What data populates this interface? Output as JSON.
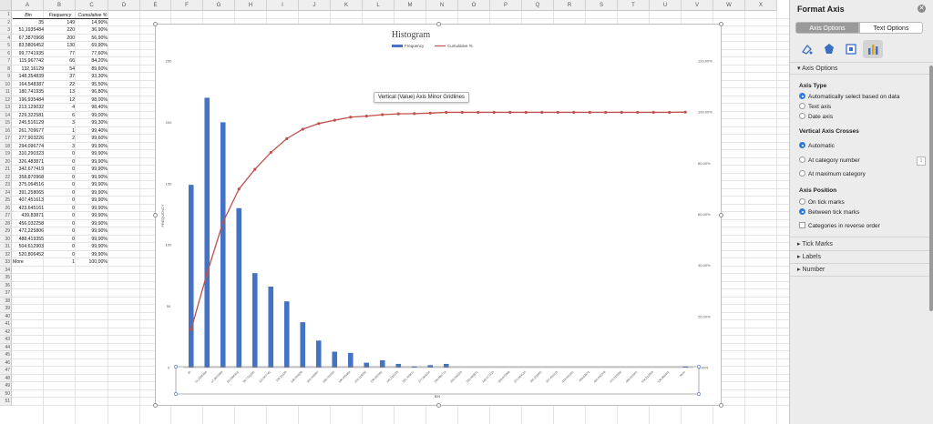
{
  "spreadsheet": {
    "columns": [
      "A",
      "B",
      "C",
      "D",
      "E",
      "F",
      "G",
      "H",
      "I",
      "J",
      "K",
      "L",
      "M",
      "N",
      "O",
      "P",
      "Q",
      "R",
      "S",
      "T",
      "U",
      "V",
      "W",
      "X"
    ],
    "row_numbers": [
      "1",
      "2",
      "3",
      "4",
      "5",
      "6",
      "7",
      "8",
      "9",
      "10",
      "11",
      "12",
      "13",
      "14",
      "15",
      "16",
      "17",
      "18",
      "19",
      "20",
      "21",
      "22",
      "23",
      "24",
      "25",
      "26",
      "27",
      "28",
      "29",
      "30",
      "31",
      "32",
      "33",
      "34",
      "35",
      "36",
      "37",
      "38",
      "39",
      "40",
      "41",
      "42",
      "43",
      "44",
      "45",
      "46",
      "47",
      "48",
      "49",
      "50",
      "51"
    ],
    "headers": {
      "bin": "Bin",
      "frequency": "Frequency",
      "cumulative": "Cumulative %"
    },
    "rows": [
      {
        "bin": "35",
        "freq": "149",
        "cum": "14,90%"
      },
      {
        "bin": "51,1935484",
        "freq": "220",
        "cum": "36,90%"
      },
      {
        "bin": "67,3870968",
        "freq": "200",
        "cum": "56,90%"
      },
      {
        "bin": "83,5806452",
        "freq": "130",
        "cum": "69,90%"
      },
      {
        "bin": "99,7741935",
        "freq": "77",
        "cum": "77,60%"
      },
      {
        "bin": "115,967742",
        "freq": "66",
        "cum": "84,20%"
      },
      {
        "bin": "132,16129",
        "freq": "54",
        "cum": "89,60%"
      },
      {
        "bin": "148,354839",
        "freq": "37",
        "cum": "93,30%"
      },
      {
        "bin": "164,548387",
        "freq": "22",
        "cum": "95,50%"
      },
      {
        "bin": "180,741935",
        "freq": "13",
        "cum": "96,80%"
      },
      {
        "bin": "196,935484",
        "freq": "12",
        "cum": "98,00%"
      },
      {
        "bin": "213,129032",
        "freq": "4",
        "cum": "98,40%"
      },
      {
        "bin": "229,322581",
        "freq": "6",
        "cum": "99,00%"
      },
      {
        "bin": "245,516129",
        "freq": "3",
        "cum": "99,30%"
      },
      {
        "bin": "261,709677",
        "freq": "1",
        "cum": "99,40%"
      },
      {
        "bin": "277,903226",
        "freq": "2",
        "cum": "99,60%"
      },
      {
        "bin": "294,096774",
        "freq": "3",
        "cum": "99,90%"
      },
      {
        "bin": "310,290323",
        "freq": "0",
        "cum": "99,90%"
      },
      {
        "bin": "326,483871",
        "freq": "0",
        "cum": "99,90%"
      },
      {
        "bin": "342,677419",
        "freq": "0",
        "cum": "99,90%"
      },
      {
        "bin": "358,870968",
        "freq": "0",
        "cum": "99,90%"
      },
      {
        "bin": "375,064516",
        "freq": "0",
        "cum": "99,90%"
      },
      {
        "bin": "391,258065",
        "freq": "0",
        "cum": "99,90%"
      },
      {
        "bin": "407,451613",
        "freq": "0",
        "cum": "99,90%"
      },
      {
        "bin": "423,645161",
        "freq": "0",
        "cum": "99,90%"
      },
      {
        "bin": "439,83871",
        "freq": "0",
        "cum": "99,90%"
      },
      {
        "bin": "456,032258",
        "freq": "0",
        "cum": "99,90%"
      },
      {
        "bin": "472,225806",
        "freq": "0",
        "cum": "99,90%"
      },
      {
        "bin": "488,419355",
        "freq": "0",
        "cum": "99,90%"
      },
      {
        "bin": "504,612903",
        "freq": "0",
        "cum": "99,90%"
      },
      {
        "bin": "520,806452",
        "freq": "0",
        "cum": "99,90%"
      },
      {
        "bin": "More",
        "freq": "1",
        "cum": "100,00%"
      }
    ]
  },
  "chart_data": {
    "type": "bar",
    "title": "Histogram",
    "xlabel": "BIN",
    "ylabel": "FREQUENCY",
    "categories": [
      "35",
      "51,1935484",
      "67,3870968",
      "83,5806452",
      "99,7741935",
      "115,967742",
      "132,16129",
      "148,354839",
      "164,548387",
      "180,741935",
      "196,935484",
      "213,129032",
      "229,322581",
      "245,516129",
      "261,709677",
      "277,903226",
      "294,096774",
      "310,290323",
      "326,483871",
      "342,677419",
      "358,870968",
      "375,064516",
      "391,258065",
      "407,451613",
      "423,645161",
      "439,83871",
      "456,032258",
      "472,225806",
      "488,419355",
      "504,612903",
      "520,806452",
      "More"
    ],
    "series": [
      {
        "name": "Frequency",
        "type": "bar",
        "color": "#4472c4",
        "values": [
          149,
          220,
          200,
          130,
          77,
          66,
          54,
          37,
          22,
          13,
          12,
          4,
          6,
          3,
          1,
          2,
          3,
          0,
          0,
          0,
          0,
          0,
          0,
          0,
          0,
          0,
          0,
          0,
          0,
          0,
          0,
          1
        ]
      },
      {
        "name": "Cumulative %",
        "type": "line",
        "color": "#c0504d",
        "axis": "secondary",
        "values": [
          14.9,
          36.9,
          56.9,
          69.9,
          77.6,
          84.2,
          89.6,
          93.3,
          95.5,
          96.8,
          98.0,
          98.4,
          99.0,
          99.3,
          99.4,
          99.6,
          99.9,
          99.9,
          99.9,
          99.9,
          99.9,
          99.9,
          99.9,
          99.9,
          99.9,
          99.9,
          99.9,
          99.9,
          99.9,
          99.9,
          99.9,
          100.0
        ]
      }
    ],
    "ylim": [
      0,
      250
    ],
    "y_ticks": [
      "0",
      "50",
      "100",
      "150",
      "200",
      "250"
    ],
    "y2lim": [
      0,
      120
    ],
    "y2_ticks": [
      "0.00%",
      "20.00%",
      "40.00%",
      "60.00%",
      "80.00%",
      "100.00%",
      "120.00%"
    ],
    "legend": "top-center",
    "grid": false
  },
  "tooltip": "Vertical (Value) Axis Minor Gridlines",
  "panel": {
    "title": "Format Axis",
    "tabs": [
      "Axis Options",
      "Text Options"
    ],
    "section": "Axis Options",
    "axis_type": {
      "title": "Axis Type",
      "options": [
        "Automatically select based on data",
        "Text axis",
        "Date axis"
      ]
    },
    "vertical_crosses": {
      "title": "Vertical Axis Crosses",
      "options": [
        "Automatic",
        "At category number",
        "At maximum category"
      ],
      "category_number": "1"
    },
    "axis_position": {
      "title": "Axis Position",
      "options": [
        "On tick marks",
        "Between tick marks"
      ],
      "reverse": "Categories in reverse order"
    },
    "collapsed": [
      "Tick Marks",
      "Labels",
      "Number"
    ]
  }
}
